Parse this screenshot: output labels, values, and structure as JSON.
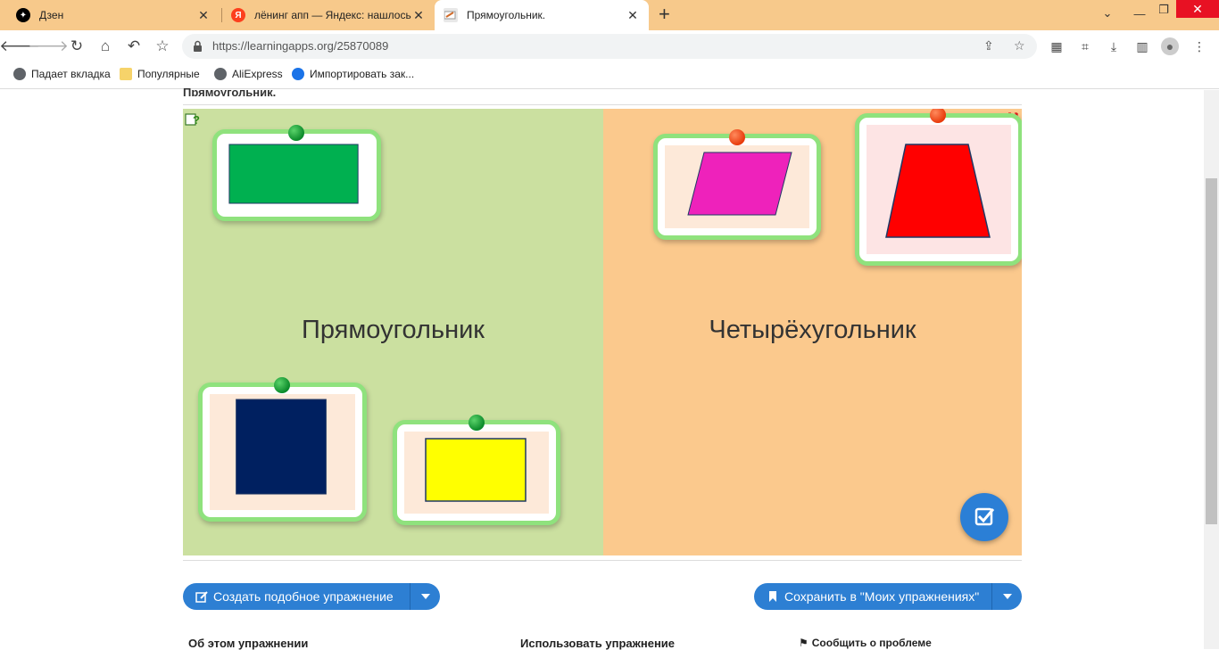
{
  "browser": {
    "tabs": [
      {
        "title": "Дзен",
        "icon": "zen-icon"
      },
      {
        "title": "лёнинг апп — Яндекс: нашлось",
        "icon": "yandex-icon"
      },
      {
        "title": "Прямоугольник.",
        "icon": "learningapps-icon",
        "active": true
      }
    ],
    "url": "https://learningapps.org/25870089",
    "bookmarks": [
      {
        "label": "Падает вкладка",
        "icon": "globe-icon"
      },
      {
        "label": "Популярные",
        "icon": "folder-icon"
      },
      {
        "label": "AliExpress",
        "icon": "globe-icon"
      },
      {
        "label": "Импортировать зак...",
        "icon": "gear-icon"
      }
    ]
  },
  "page": {
    "heading": "Прямоугольник.",
    "zones": [
      {
        "label": "Прямоугольник",
        "color": "#cbe0a0"
      },
      {
        "label": "Четырёхугольник",
        "color": "#fbc98d"
      }
    ],
    "cards": [
      {
        "shape": "green rectangle",
        "fill": "#00b050",
        "pin": "green"
      },
      {
        "shape": "navy rectangle",
        "fill": "#002060",
        "pin": "green"
      },
      {
        "shape": "yellow rectangle",
        "fill": "#ffff00",
        "pin": "green"
      },
      {
        "shape": "magenta parallelogram",
        "fill": "#ee22bb",
        "pin": "red"
      },
      {
        "shape": "red trapezoid",
        "fill": "#ff0000",
        "pin": "red"
      }
    ],
    "create_similar_label": "Создать подобное упражнение",
    "save_label": "Сохранить в \"Моих упражнениях\"",
    "footer": {
      "about": "Об этом упражнении",
      "use": "Использовать упражнение",
      "report": "Сообщить о проблеме"
    }
  }
}
